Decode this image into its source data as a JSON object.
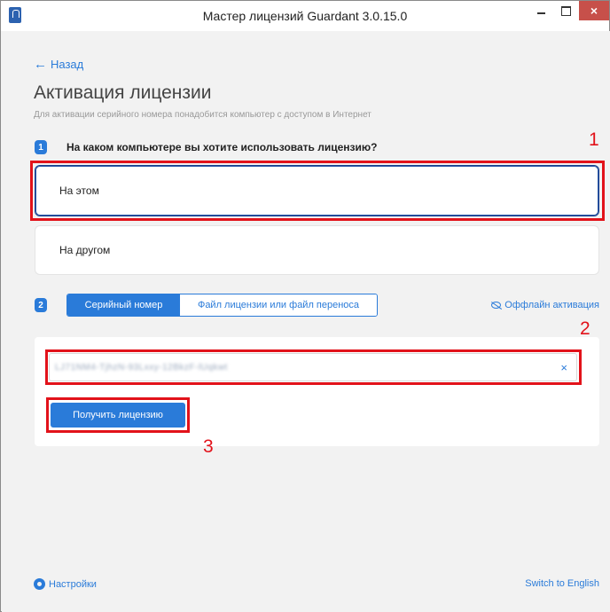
{
  "window": {
    "title": "Мастер лицензий Guardant 3.0.15.0",
    "close_glyph": "×"
  },
  "nav": {
    "back_label": "Назад",
    "back_arrow": "←"
  },
  "page": {
    "title": "Активация лицензии",
    "subtitle": "Для активации серийного номера понадобится компьютер с доступом в Интернет"
  },
  "step1": {
    "badge": "1",
    "question": "На каком компьютере вы хотите использовать лицензию?",
    "options": [
      {
        "label": "На этом",
        "selected": true
      },
      {
        "label": "На другом",
        "selected": false
      }
    ]
  },
  "step2": {
    "badge": "2",
    "tabs": [
      {
        "label": "Серийный номер",
        "active": true
      },
      {
        "label": "Файл лицензии или файл переноса",
        "active": false
      }
    ],
    "offline_label": "Оффлайн активация",
    "serial_value": "LJ71NM4-TjhzN-93Lxxy-12BkzF-lUqkwt",
    "clear_glyph": "×",
    "get_button": "Получить лицензию"
  },
  "annotations": {
    "n1": "1",
    "n2": "2",
    "n3": "3",
    "color": "#e2121a"
  },
  "footer": {
    "settings_label": "Настройки",
    "language_link": "Switch to English"
  },
  "colors": {
    "accent": "#2a7bd9",
    "selected_border": "#1a3f8c",
    "background": "#f2f2f2"
  }
}
